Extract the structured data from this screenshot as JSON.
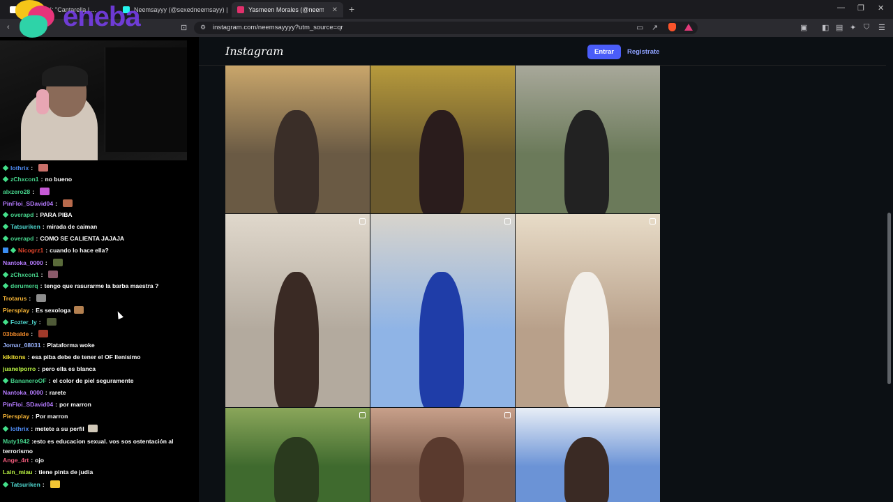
{
  "browser": {
    "tabs": [
      {
        "label": "[...art] on X: \"Cantarella | ...",
        "favicon_color": "#ffffff"
      },
      {
        "label": "Neemsayyy (@sexedneemsayy) | Tik",
        "favicon_color": "#25f4ee"
      },
      {
        "label": "Yasmeen Morales (@neemsayyy",
        "favicon_color": "#e1306c",
        "active": true
      }
    ],
    "url": "instagram.com/neemsayyyy?utm_source=qr"
  },
  "overlay": {
    "brand": "eneba"
  },
  "chat": {
    "messages": [
      {
        "user": "lothrix",
        "color": "#4f8df7",
        "text": "",
        "emote": "#c9706a"
      },
      {
        "user": "zChxcon1",
        "color": "#46d38b",
        "text": "no bueno"
      },
      {
        "user": "alxzero28",
        "color": "#46d38b",
        "text": "",
        "emote": "#c659d6",
        "nobadge": true
      },
      {
        "user": "PinFloi_SDavid04",
        "color": "#b57bff",
        "text": "",
        "emote": "#b86a4c",
        "nobadge": true
      },
      {
        "user": "overapd",
        "color": "#46d38b",
        "text": "PARA PIBA"
      },
      {
        "user": "Tatsuriken",
        "color": "#4fd8d0",
        "text": "mirada de caiman"
      },
      {
        "user": "overapd",
        "color": "#46d38b",
        "text": "COMO SE CALIENTA JAJAJA"
      },
      {
        "user": "Nicogrz1",
        "color": "#e3462c",
        "text": "cuando lo hace ella?",
        "extrabadge": true
      },
      {
        "user": "Nantoka_0000",
        "color": "#b57bff",
        "text": "",
        "emote": "#5a6b3a",
        "nobadge": true
      },
      {
        "user": "zChxcon1",
        "color": "#46d38b",
        "text": "",
        "emote": "#8a5a6a"
      },
      {
        "user": "derumerq",
        "color": "#46d38b",
        "text": "tengo que rasurarme la barba maestra ?"
      },
      {
        "user": "Trotarus",
        "color": "#f2b134",
        "text": "",
        "emote": "#8e8e8e",
        "nobadge": true
      },
      {
        "user": "Piersplay",
        "color": "#f2b134",
        "text": "Es sexologa",
        "emote": "#b38050",
        "nobadge": true
      },
      {
        "user": "Fozter_ly",
        "color": "#4fd8d0",
        "text": "",
        "emote": "#4f5a38"
      },
      {
        "user": "03bbalde",
        "color": "#f28b2b",
        "text": "",
        "emote": "#a03a2a",
        "nobadge": true
      },
      {
        "user": "Jomar_08031",
        "color": "#9ab4ff",
        "text": "Plataforma woke",
        "nobadge": true
      },
      {
        "user": "kikitons",
        "color": "#f2e234",
        "text": "esa piba debe de tener el OF llenisimo",
        "nobadge": true
      },
      {
        "user": "juanelporro",
        "color": "#b9f242",
        "text": "pero ella es blanca",
        "nobadge": true
      },
      {
        "user": "BananeroOF",
        "color": "#46d38b",
        "text": "el color de piel seguramente"
      },
      {
        "user": "Nantoka_0000",
        "color": "#b57bff",
        "text": "rarete",
        "nobadge": true
      },
      {
        "user": "PinFloi_SDavid04",
        "color": "#b57bff",
        "text": "por marron",
        "nobadge": true
      },
      {
        "user": "Piersplay",
        "color": "#f2b134",
        "text": "Por marron",
        "nobadge": true
      },
      {
        "user": "lothrix",
        "color": "#4f8df7",
        "text": "metete a su perfil",
        "emote": "#d0c8b8"
      },
      {
        "user": "Maty1942",
        "color": "#46d38b",
        "text": "esto es educacion sexual. vos sos ostentación al terrorismo",
        "wrap": true
      },
      {
        "user": "Ange_4rt",
        "color": "#f05a7a",
        "text": "ojo",
        "nobadge": true
      },
      {
        "user": "Lain_miau",
        "color": "#b9f242",
        "text": "tiene pinta de judia",
        "nobadge": true
      },
      {
        "user": "Tatsuriken",
        "color": "#4fd8d0",
        "text": "",
        "emote": "#f2c534"
      }
    ]
  },
  "instagram": {
    "logo": "Instagram",
    "login_label": "Entrar",
    "signup_label": "Registrate",
    "photos": [
      {
        "bg": "#6a5a44",
        "accent": "#c9a66b",
        "fig": "#3a2e28",
        "multi": false
      },
      {
        "bg": "#6b5a2e",
        "accent": "#b79a3c",
        "fig": "#2a1c1c",
        "multi": false
      },
      {
        "bg": "#6b7a5a",
        "accent": "#a8a89a",
        "fig": "#222222",
        "multi": false
      },
      {
        "bg": "#b3aa9e",
        "accent": "#e0d8cc",
        "fig": "#3a2a24",
        "multi": true
      },
      {
        "bg": "#8fb4e6",
        "accent": "#d8d4cc",
        "fig": "#1f3da8",
        "multi": true
      },
      {
        "bg": "#b8a08a",
        "accent": "#e8dcc8",
        "fig": "#f2eee8",
        "multi": true
      },
      {
        "bg": "#3f6a2e",
        "accent": "#8aa65a",
        "fig": "#2a3a1e",
        "multi": true
      },
      {
        "bg": "#7a5a4a",
        "accent": "#c8a08a",
        "fig": "#5a3a2e",
        "multi": true
      },
      {
        "bg": "#6b93d6",
        "accent": "#e8eef6",
        "fig": "#3a2a24",
        "multi": false
      }
    ]
  }
}
